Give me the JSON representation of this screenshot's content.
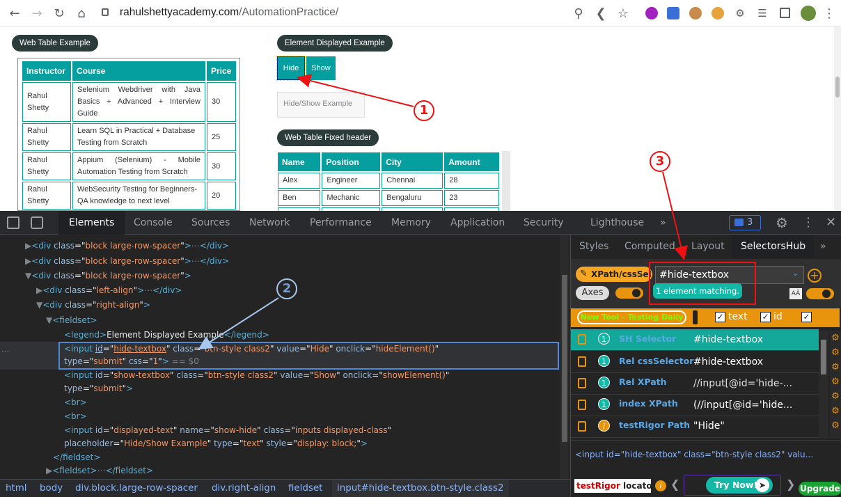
{
  "browser": {
    "url_host": "rahulshettyacademy.com",
    "url_path": "/AutomationPractice/",
    "icons": [
      "back-icon",
      "forward-icon",
      "reload-icon",
      "home-icon",
      "lock-icon",
      "zoom-icon",
      "share-icon",
      "star-icon",
      "extensions-icon",
      "profile-avatar"
    ]
  },
  "page": {
    "web_table_label": "Web Table Example",
    "element_displayed_label": "Element Displayed Example",
    "hide_button": "Hide",
    "show_button": "Show",
    "hide_show_placeholder": "Hide/Show Example",
    "fixed_header_label": "Web Table Fixed header",
    "web_table": {
      "headers": [
        "Instructor",
        "Course",
        "Price"
      ],
      "rows": [
        [
          "Rahul Shetty",
          "Selenium Webdriver with Java Basics + Advanced + Interview Guide",
          "30"
        ],
        [
          "Rahul Shetty",
          "Learn SQL in Practical + Database Testing from Scratch",
          "25"
        ],
        [
          "Rahul Shetty",
          "Appium (Selenium) - Mobile Automation Testing from Scratch",
          "30"
        ],
        [
          "Rahul Shetty",
          "WebSecurity Testing for Beginners-QA knowledge to next level",
          "20"
        ]
      ]
    },
    "fixed_table": {
      "headers": [
        "Name",
        "Position",
        "City",
        "Amount"
      ],
      "rows": [
        [
          "Alex",
          "Engineer",
          "Chennai",
          "28"
        ],
        [
          "Ben",
          "Mechanic",
          "Bengaluru",
          "23"
        ]
      ]
    }
  },
  "devtools": {
    "tabs": [
      "Elements",
      "Console",
      "Sources",
      "Network",
      "Performance",
      "Memory",
      "Application",
      "Security",
      "Lighthouse"
    ],
    "more_tabs": "»",
    "issues_count": "3",
    "breadcrumbs": [
      "html",
      "body",
      "div.block.large-row-spacer",
      "div.right-align",
      "fieldset",
      "input#hide-textbox.btn-style.class2"
    ],
    "right_tabs": [
      "Styles",
      "Computed",
      "Layout",
      "SelectorsHub"
    ],
    "eq_dollar": "== $0"
  },
  "selectorshub": {
    "xpath_button": "XPath/cssSel...",
    "selector_input": "#hide-textbox",
    "match_text": "1 element matching.",
    "axes_label": "Axes",
    "new_tool_label": "New Tool - Testing Daily",
    "checkbox_text": "text",
    "checkbox_id": "id",
    "selectors": [
      {
        "count": "1",
        "name": "SH Selector",
        "value": "#hide-textbox"
      },
      {
        "count": "1",
        "name": "Rel cssSelector",
        "value": "#hide-textbox"
      },
      {
        "count": "1",
        "name": "Rel XPath",
        "value": "//input[@id='hide-..."
      },
      {
        "count": "1",
        "name": "index XPath",
        "value": "(//input[@id='hide..."
      },
      {
        "count": "i",
        "name": "testRigor Path",
        "value": "\"Hide\""
      }
    ],
    "preview": "<input id=\"hide-textbox\" class=\"btn-style class2\" valu...",
    "testrigor_prefix": "testRigor",
    "testrigor_suffix": " locators",
    "try_now": "Try Now!",
    "upgrade": "Upgrade"
  },
  "annotations": {
    "marker1": "1",
    "marker2": "2",
    "marker3": "3",
    "color": "#e11"
  }
}
